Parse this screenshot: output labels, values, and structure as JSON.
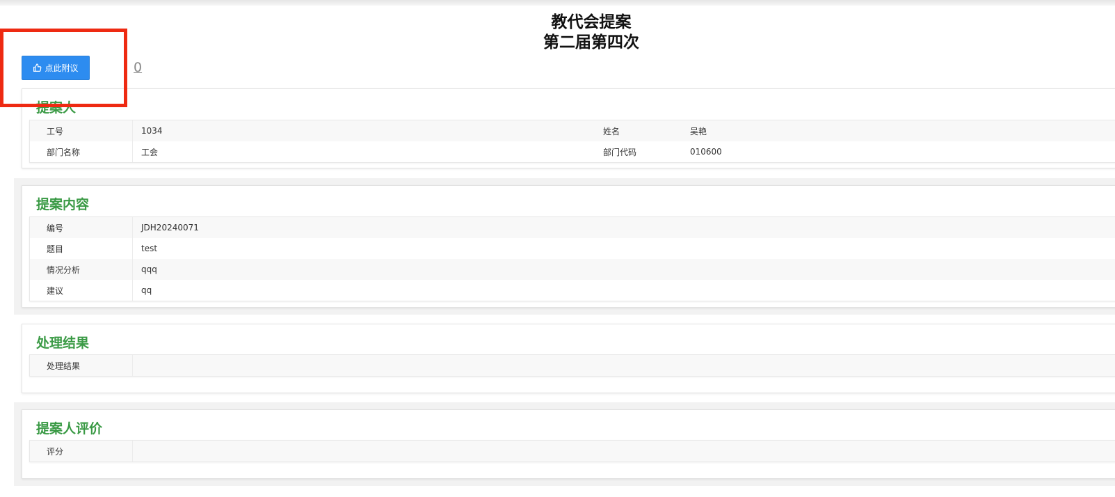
{
  "header": {
    "title": "教代会提案",
    "subtitle": "第二届第四次"
  },
  "like": {
    "button_label": "点此附议",
    "icon": "thumbs-up-icon",
    "count": "0"
  },
  "colors": {
    "accent": "#2d8cf0",
    "section_title": "#3a9a45",
    "highlight": "#ee2a12"
  },
  "proposer": {
    "title": "提案人",
    "fields": {
      "id_label": "工号",
      "id_value": "1034",
      "name_label": "姓名",
      "name_value": "吴艳",
      "dept_label": "部门名称",
      "dept_value": "工会",
      "dept_code_label": "部门代码",
      "dept_code_value": "010600"
    }
  },
  "content": {
    "title": "提案内容",
    "rows": [
      {
        "label": "编号",
        "value": "JDH20240071"
      },
      {
        "label": "题目",
        "value": "test"
      },
      {
        "label": "情况分析",
        "value": "qqq"
      },
      {
        "label": "建议",
        "value": "qq"
      }
    ]
  },
  "result": {
    "title": "处理结果",
    "rows": [
      {
        "label": "处理结果",
        "value": ""
      }
    ]
  },
  "evaluation": {
    "title": "提案人评价",
    "rows": [
      {
        "label": "评分",
        "value": ""
      }
    ]
  }
}
